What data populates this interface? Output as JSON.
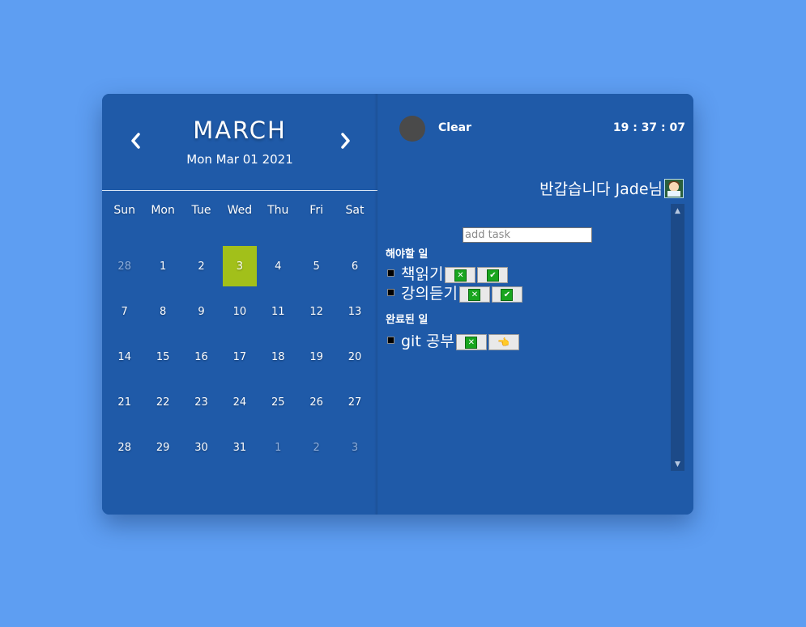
{
  "calendar": {
    "month": "MARCH",
    "full_date": "Mon Mar 01 2021",
    "prev_icon": "chevron-left-icon",
    "next_icon": "chevron-right-icon",
    "weekdays": [
      "Sun",
      "Mon",
      "Tue",
      "Wed",
      "Thu",
      "Fri",
      "Sat"
    ],
    "days": [
      {
        "label": "28",
        "muted": true
      },
      {
        "label": "1"
      },
      {
        "label": "2"
      },
      {
        "label": "3",
        "today": true
      },
      {
        "label": "4"
      },
      {
        "label": "5"
      },
      {
        "label": "6"
      },
      {
        "label": "7"
      },
      {
        "label": "8"
      },
      {
        "label": "9"
      },
      {
        "label": "10"
      },
      {
        "label": "11"
      },
      {
        "label": "12"
      },
      {
        "label": "13"
      },
      {
        "label": "14"
      },
      {
        "label": "15"
      },
      {
        "label": "16"
      },
      {
        "label": "17"
      },
      {
        "label": "18"
      },
      {
        "label": "19"
      },
      {
        "label": "20"
      },
      {
        "label": "21"
      },
      {
        "label": "22"
      },
      {
        "label": "23"
      },
      {
        "label": "24"
      },
      {
        "label": "25"
      },
      {
        "label": "26"
      },
      {
        "label": "27"
      },
      {
        "label": "28"
      },
      {
        "label": "29"
      },
      {
        "label": "30"
      },
      {
        "label": "31"
      },
      {
        "label": "1",
        "muted": true
      },
      {
        "label": "2",
        "muted": true
      },
      {
        "label": "3",
        "muted": true
      }
    ],
    "today_color": "#a2c01a"
  },
  "header": {
    "clear_label": "Clear",
    "clock": "19 : 37 : 07"
  },
  "greeting": {
    "text": "반갑습니다 Jade님",
    "icon": "user-avatar-icon"
  },
  "todo": {
    "input_placeholder": "add task",
    "input_value": "",
    "pending_title": "해야할 일",
    "pending": [
      {
        "text": "책읽기"
      },
      {
        "text": "강의듣기"
      }
    ],
    "done_title": "완료된 일",
    "done": [
      {
        "text": "git 공부"
      }
    ]
  },
  "colors": {
    "background": "#5e9ef2",
    "panel": "#1f5aa8",
    "today": "#a2c01a"
  }
}
